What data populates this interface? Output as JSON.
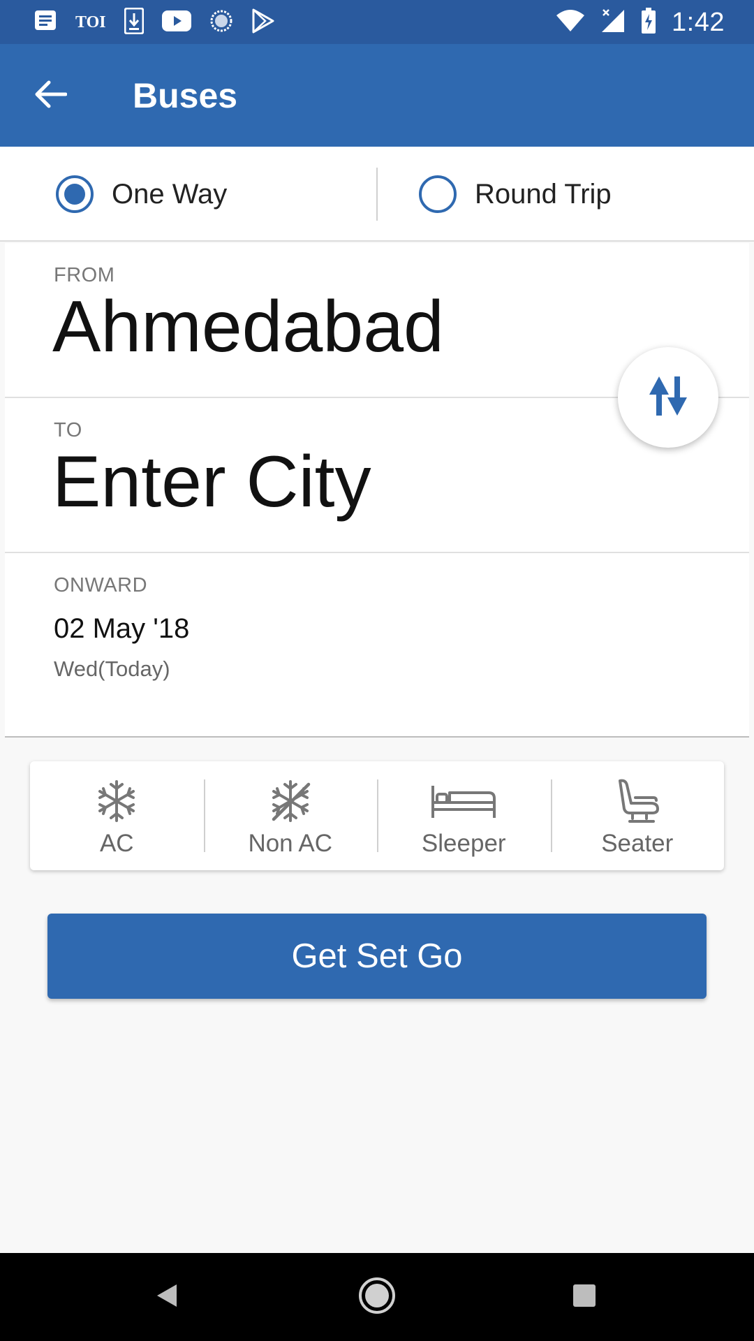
{
  "status_bar": {
    "time": "1:42",
    "toi_label": "TOI",
    "left_icons": [
      "messages-icon",
      "toi-icon",
      "download-icon",
      "youtube-icon",
      "sync-icon",
      "play-store-icon"
    ],
    "right_icons": [
      "wifi-icon",
      "signal-icon",
      "battery-charging-icon"
    ]
  },
  "app_bar": {
    "title": "Buses",
    "back_icon": "arrow-left-icon"
  },
  "trip_type": {
    "options": [
      {
        "label": "One Way",
        "selected": true
      },
      {
        "label": "Round Trip",
        "selected": false
      }
    ]
  },
  "from": {
    "label": "FROM",
    "value": "Ahmedabad"
  },
  "to": {
    "label": "TO",
    "value": "Enter City"
  },
  "onward": {
    "label": "ONWARD",
    "date": "02 May '18",
    "day": "Wed(Today)"
  },
  "swap_icon": "swap-vertical-icon",
  "filters": [
    {
      "label": "AC",
      "icon": "snowflake-icon"
    },
    {
      "label": "Non AC",
      "icon": "snowflake-off-icon"
    },
    {
      "label": "Sleeper",
      "icon": "bed-icon"
    },
    {
      "label": "Seater",
      "icon": "seat-icon"
    }
  ],
  "cta": {
    "label": "Get Set Go"
  },
  "colors": {
    "status_bar": "#2a5a9e",
    "primary": "#2f69b0",
    "background": "#f8f8f8"
  },
  "nav_bar": {
    "icons": [
      "nav-back-icon",
      "nav-home-icon",
      "nav-recents-icon"
    ]
  }
}
